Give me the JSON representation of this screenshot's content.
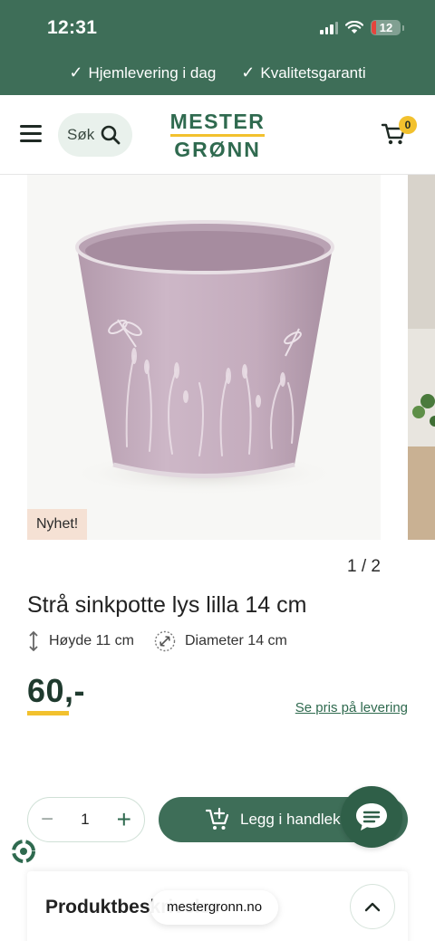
{
  "status_bar": {
    "time": "12:31",
    "battery": "12"
  },
  "usp": {
    "items": [
      "Hjemlevering i dag",
      "Kvalitetsgaranti"
    ],
    "check": "✓"
  },
  "header": {
    "search_label": "Søk",
    "logo_line1": "MESTER",
    "logo_line2": "GRØNN",
    "cart_count": "0"
  },
  "product": {
    "badge": "Nyhet!",
    "pager": "1 / 2",
    "title": "Strå sinkpotte lys lilla 14 cm",
    "height_label": "Høyde 11 cm",
    "diameter_label": "Diameter 14 cm",
    "price": "60,-",
    "delivery_link": "Se pris på levering",
    "quantity": "1",
    "add_to_cart": "Legg i handlek"
  },
  "description": {
    "title": "Produktbeskrivelse"
  },
  "browser": {
    "url": "mestergronn.no"
  },
  "colors": {
    "brand_green": "#3e6e58",
    "accent_yellow": "#f2c12e",
    "pot_lilac": "#c9b3c3"
  }
}
